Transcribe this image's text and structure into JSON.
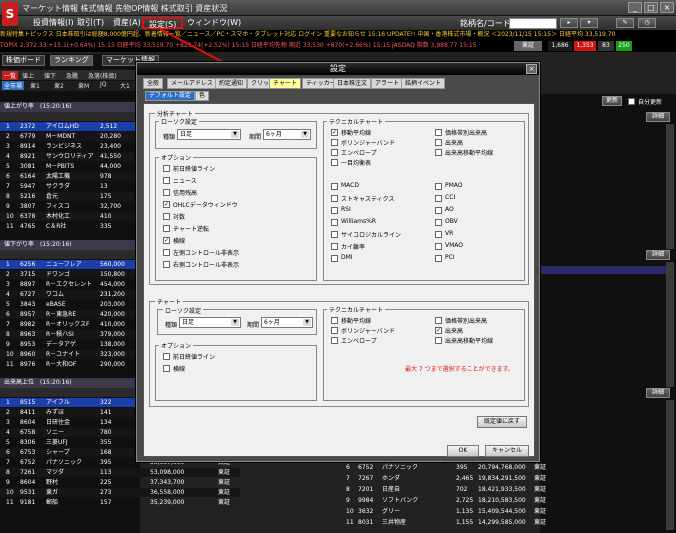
{
  "window": {
    "title": "マーケット情報 株式情報 先物OP情報 株式取引 資産状況",
    "logo": "S"
  },
  "menubar": {
    "items": [
      "投資情報(I)",
      "取引(T)",
      "資産(A)",
      "設定(S)",
      "ウィンドウ(W)"
    ],
    "stock_code_label": "銘柄名/コード："
  },
  "ticker": {
    "line1": "新規特集トピックス 日本株取引は総額8,000億円超、新着情報一覧／ニュース／PC・スマホ・タブレット対応 ログイン 重要なお知らせ 15:16 UPDATE!! 中国・香港株式市場・概況 ＜2023/11/15 15:15＞ 日経平均 33,519.70",
    "line2": "TOPIX 2,372.33 +15.1(+0.64%) 15:15 日経平均 33,519.70 +823.74(+2.52%) 15:15 日経平均先物 期近 33,530 +870(+2.66%) 15:15 JASDAQ 指数 3,988.77 15:15",
    "chip_left": "東証",
    "chip_a": "1,686",
    "chip_b": "1,353",
    "chip_c": "83",
    "chip_d": "250"
  },
  "left_panel": {
    "tabs": [
      "株価ボード",
      "ランキング",
      "マーケット情報"
    ],
    "sub_tabs": [
      "一覧",
      "値上",
      "値下",
      "急騰",
      "急落(株価)",
      "騰落率"
    ],
    "market_tabs": [
      "全市場",
      "東1",
      "東2",
      "東M",
      "JQ",
      "大1"
    ],
    "sections": [
      {
        "title": "値上がり率　(15:20:16)",
        "rows": [
          {
            "no": "1",
            "code": "2372",
            "name": "アイロムHD",
            "price": "2,512"
          },
          {
            "no": "2",
            "code": "6779",
            "name": "M－MDNT",
            "price": "20,280"
          },
          {
            "no": "3",
            "code": "8914",
            "name": "ランビジネス",
            "price": "23,400"
          },
          {
            "no": "4",
            "code": "8921",
            "name": "サンウロリティア",
            "price": "41,550"
          },
          {
            "no": "5",
            "code": "3081",
            "name": "M－PBITS",
            "price": "44,000"
          },
          {
            "no": "6",
            "code": "6164",
            "name": "太陽工機",
            "price": "978"
          },
          {
            "no": "7",
            "code": "5947",
            "name": "サクラダ",
            "price": "13"
          },
          {
            "no": "8",
            "code": "5216",
            "name": "倉元",
            "price": "175"
          },
          {
            "no": "9",
            "code": "3807",
            "name": "フィスコ",
            "price": "32,700"
          },
          {
            "no": "10",
            "code": "6378",
            "name": "木村化工",
            "price": "410"
          },
          {
            "no": "11",
            "code": "4765",
            "name": "C＆R社",
            "price": "335"
          }
        ]
      },
      {
        "title": "値下がり率　(15:20:16)",
        "rows": [
          {
            "no": "1",
            "code": "6256",
            "name": "ニューフレア",
            "price": "560,000"
          },
          {
            "no": "2",
            "code": "3715",
            "name": "ドワンゴ",
            "price": "150,800"
          },
          {
            "no": "3",
            "code": "8897",
            "name": "R－エクセレント",
            "price": "454,000"
          },
          {
            "no": "4",
            "code": "6727",
            "name": "ワコム",
            "price": "231,200"
          },
          {
            "no": "5",
            "code": "3843",
            "name": "eBASE",
            "price": "203,000"
          },
          {
            "no": "6",
            "code": "8957",
            "name": "R－東急RE",
            "price": "420,000"
          },
          {
            "no": "7",
            "code": "8982",
            "name": "R－オリックスF",
            "price": "410,000"
          },
          {
            "no": "8",
            "code": "8963",
            "name": "R－積ハSI",
            "price": "379,000"
          },
          {
            "no": "9",
            "code": "8953",
            "name": "デ－タアゲ",
            "price": "138,000"
          },
          {
            "no": "10",
            "code": "8960",
            "name": "R－ユナイト",
            "price": "323,000"
          },
          {
            "no": "11",
            "code": "8976",
            "name": "R－大和OF",
            "price": "290,000"
          }
        ]
      },
      {
        "title": "出来高上位　(15:20:16)",
        "rows": [
          {
            "no": "1",
            "code": "8515",
            "name": "アイフル",
            "price": "322",
            "vol": "",
            "mkt": ""
          },
          {
            "no": "2",
            "code": "8411",
            "name": "みずほ",
            "price": "141",
            "vol": "",
            "mkt": ""
          },
          {
            "no": "3",
            "code": "8604",
            "name": "日研住金",
            "price": "134",
            "vol": "",
            "mkt": ""
          },
          {
            "no": "4",
            "code": "6758",
            "name": "ソニー",
            "price": "780",
            "vol": "",
            "mkt": ""
          },
          {
            "no": "5",
            "code": "8306",
            "name": "三菱UFJ",
            "price": "355",
            "vol": "",
            "mkt": ""
          },
          {
            "no": "6",
            "code": "6753",
            "name": "シャープ",
            "price": "168",
            "vol": "57,635,000",
            "mkt": "東証"
          },
          {
            "no": "7",
            "code": "6752",
            "name": "パナソニック",
            "price": "395",
            "vol": "53,657,000",
            "mkt": "東証"
          },
          {
            "no": "8",
            "code": "7261",
            "name": "マツダ",
            "price": "113",
            "vol": "53,098,000",
            "mkt": "東証"
          },
          {
            "no": "9",
            "code": "8604",
            "name": "野村",
            "price": "225",
            "vol": "37,343,700",
            "mkt": "東証"
          },
          {
            "no": "10",
            "code": "9531",
            "name": "東ガ",
            "price": "273",
            "vol": "36,558,000",
            "mkt": "東証"
          },
          {
            "no": "11",
            "code": "9181",
            "name": "郵船",
            "price": "157",
            "vol": "35,239,000",
            "mkt": "東証"
          }
        ]
      }
    ]
  },
  "right_panel": {
    "detail_label": "詳細",
    "update_label": "更新",
    "check_label": "自分更新",
    "bottom_rows": [
      {
        "no": "6",
        "code": "6752",
        "name": "パナソニック",
        "price": "395",
        "vol": "20,794,768,000",
        "mkt": "東証"
      },
      {
        "no": "7",
        "code": "7267",
        "name": "ホンダ",
        "price": "2,465",
        "vol": "19,834,291,500",
        "mkt": "東証"
      },
      {
        "no": "8",
        "code": "7201",
        "name": "日産自",
        "price": "702",
        "vol": "18,421,933,500",
        "mkt": "東証"
      },
      {
        "no": "9",
        "code": "9984",
        "name": "ソフトバンク",
        "price": "2,725",
        "vol": "18,210,583,500",
        "mkt": "東証"
      },
      {
        "no": "10",
        "code": "3632",
        "name": "グリー",
        "price": "1,135",
        "vol": "15,409,544,500",
        "mkt": "東証"
      },
      {
        "no": "11",
        "code": "8031",
        "name": "三井物産",
        "price": "1,155",
        "vol": "14,299,585,000",
        "mkt": "東証"
      }
    ]
  },
  "dialog": {
    "title": "設定",
    "tabs": [
      "全般",
      "メールアドレス",
      "約定通知",
      "クリック",
      "チャート",
      "ティッカー",
      "日本株注文",
      "アラート",
      "銘柄イベント"
    ],
    "active_tab": "チャート",
    "sub_tabs": [
      "デフォルト設定",
      "色"
    ],
    "top": {
      "section_label": "分析チャート",
      "rosoku_label": "ローソク設定",
      "type_label": "種類",
      "type_value": "日足",
      "period_label": "期間",
      "period_value": "6ヶ月",
      "options_label": "オプション",
      "options": [
        {
          "label": "前日終値ライン",
          "checked": false
        },
        {
          "label": "ニュース",
          "checked": false
        },
        {
          "label": "信用残高",
          "checked": false
        },
        {
          "label": "OHLCデータウィンドウ",
          "checked": true
        },
        {
          "label": "対数",
          "checked": false
        },
        {
          "label": "チャート逆転",
          "checked": false
        },
        {
          "label": "横線",
          "checked": true
        },
        {
          "label": "左側コントロール非表示",
          "checked": false
        },
        {
          "label": "右側コントロール非表示",
          "checked": false
        }
      ],
      "tech_label": "テクニカルチャート",
      "tech_left": [
        {
          "label": "移動平均線",
          "checked": true
        },
        {
          "label": "ボリンジャーバンド",
          "checked": false
        },
        {
          "label": "エンベロープ",
          "checked": false
        },
        {
          "label": "一目均衡表",
          "checked": false
        }
      ],
      "tech_right": [
        {
          "label": "価格帯別出来高",
          "checked": false
        },
        {
          "label": "出来高",
          "checked": false
        },
        {
          "label": "出来高移動平均線",
          "checked": false
        }
      ],
      "osc_left": [
        {
          "label": "MACD",
          "checked": false
        },
        {
          "label": "ストキャスティクス",
          "checked": false
        },
        {
          "label": "RSI",
          "checked": false
        },
        {
          "label": "Williams%R",
          "checked": false
        },
        {
          "label": "サイコロジカルライン",
          "checked": false
        },
        {
          "label": "カイ離率",
          "checked": false
        },
        {
          "label": "DMI",
          "checked": false
        }
      ],
      "osc_right": [
        {
          "label": "PMAO",
          "checked": false
        },
        {
          "label": "CCI",
          "checked": false
        },
        {
          "label": "AO",
          "checked": false
        },
        {
          "label": "OBV",
          "checked": false
        },
        {
          "label": "VR",
          "checked": false
        },
        {
          "label": "VMAO",
          "checked": false
        },
        {
          "label": "PCI",
          "checked": false
        }
      ]
    },
    "bottom": {
      "section_label": "チャート",
      "rosoku_label": "ローソク設定",
      "type_label": "種類",
      "type_value": "日足",
      "period_label": "期間",
      "period_value": "6ヶ月",
      "options_label": "オプション",
      "options": [
        {
          "label": "前日終値ライン",
          "checked": false
        },
        {
          "label": "横線",
          "checked": false
        }
      ],
      "tech_label": "テクニカルチャート",
      "tech_left": [
        {
          "label": "移動平均線",
          "checked": false
        },
        {
          "label": "ボリンジャーバンド",
          "checked": false
        },
        {
          "label": "エンベロープ",
          "checked": false
        }
      ],
      "tech_right": [
        {
          "label": "価格帯別出来高",
          "checked": false
        },
        {
          "label": "出来高",
          "checked": true
        },
        {
          "label": "出来高移動平均線",
          "checked": false
        }
      ],
      "warning": "最大 7 つまで選択することができます。"
    },
    "reset_label": "既定値に戻す",
    "ok_label": "OK",
    "cancel_label": "キャンセル"
  },
  "colors": {
    "highlight": "#e01010",
    "row_select": "#1c3ea8",
    "up": "#ff5a5a"
  }
}
